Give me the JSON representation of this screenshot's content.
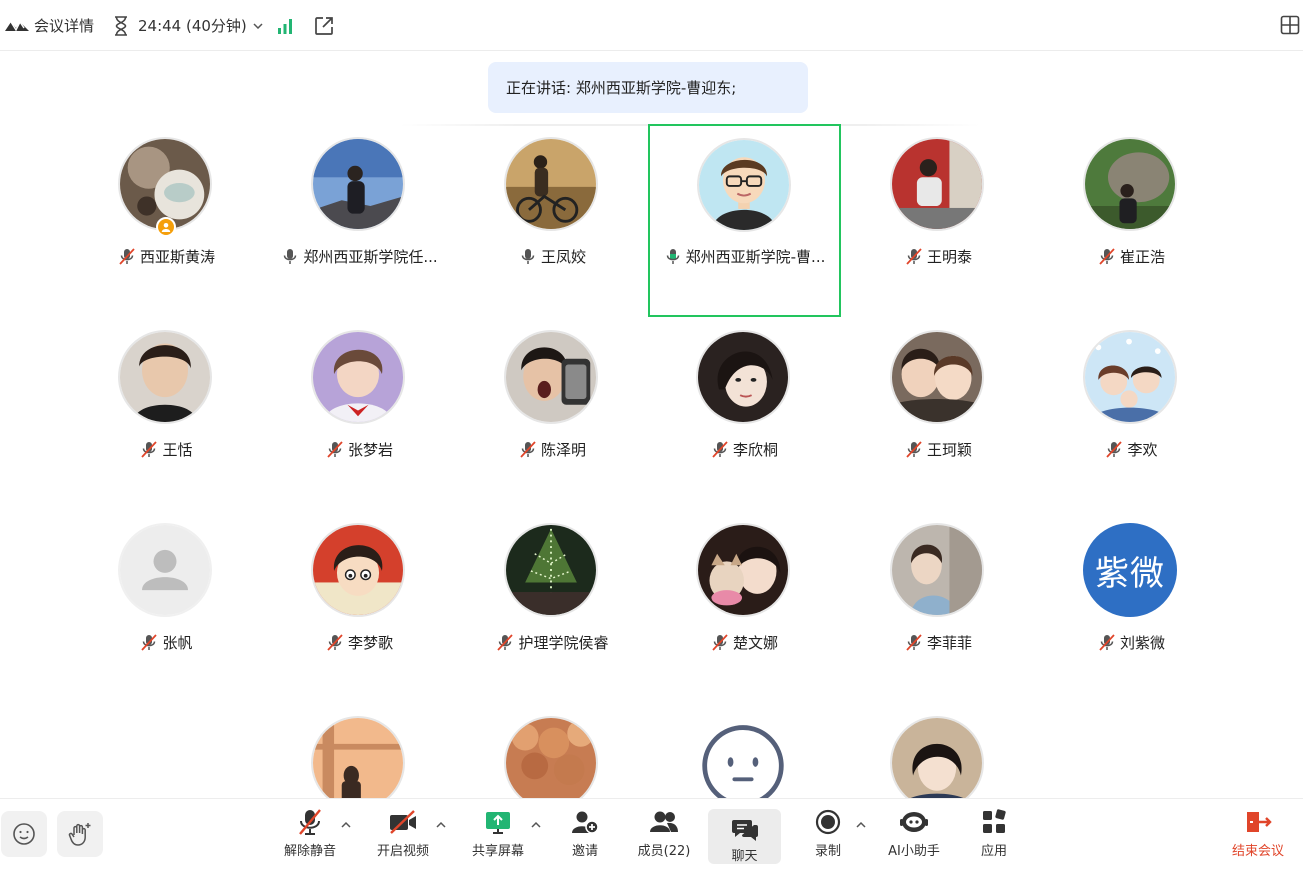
{
  "topbar": {
    "meeting_details": "会议详情",
    "timer": "24:44 (40分钟)"
  },
  "banner": {
    "speaking": "正在讲话: 郑州西亚斯学院-曹迎东;"
  },
  "participants": [
    {
      "name": "西亚斯黄涛",
      "mic": "muted",
      "host": true
    },
    {
      "name": "郑州西亚斯学院任...",
      "mic": "on"
    },
    {
      "name": "王凤姣",
      "mic": "on"
    },
    {
      "name": "郑州西亚斯学院-曹...",
      "mic": "speaking",
      "active": true
    },
    {
      "name": "王明泰",
      "mic": "muted"
    },
    {
      "name": "崔正浩",
      "mic": "muted"
    },
    {
      "name": "王恬",
      "mic": "muted"
    },
    {
      "name": "张梦岩",
      "mic": "muted"
    },
    {
      "name": "陈泽明",
      "mic": "muted"
    },
    {
      "name": "李欣桐",
      "mic": "muted"
    },
    {
      "name": "王珂颖",
      "mic": "muted"
    },
    {
      "name": "李欢",
      "mic": "muted"
    },
    {
      "name": "张帆",
      "mic": "muted"
    },
    {
      "name": "李梦歌",
      "mic": "muted"
    },
    {
      "name": "护理学院侯睿",
      "mic": "muted"
    },
    {
      "name": "楚文娜",
      "mic": "muted"
    },
    {
      "name": "李菲菲",
      "mic": "muted"
    },
    {
      "name": "刘紫微",
      "mic": "muted",
      "avatar_text": "紫微"
    }
  ],
  "toolbar": {
    "unmute": "解除静音",
    "start_video": "开启视频",
    "share_screen": "共享屏幕",
    "invite": "邀请",
    "members": "成员(22)",
    "chat": "聊天",
    "record": "录制",
    "ai_assistant": "AI小助手",
    "apps": "应用",
    "end_meeting": "结束会议"
  },
  "colors": {
    "active_border": "#22c55e",
    "end_red": "#e0452a",
    "share_green": "#22b573",
    "host_badge": "#f59f0b"
  }
}
